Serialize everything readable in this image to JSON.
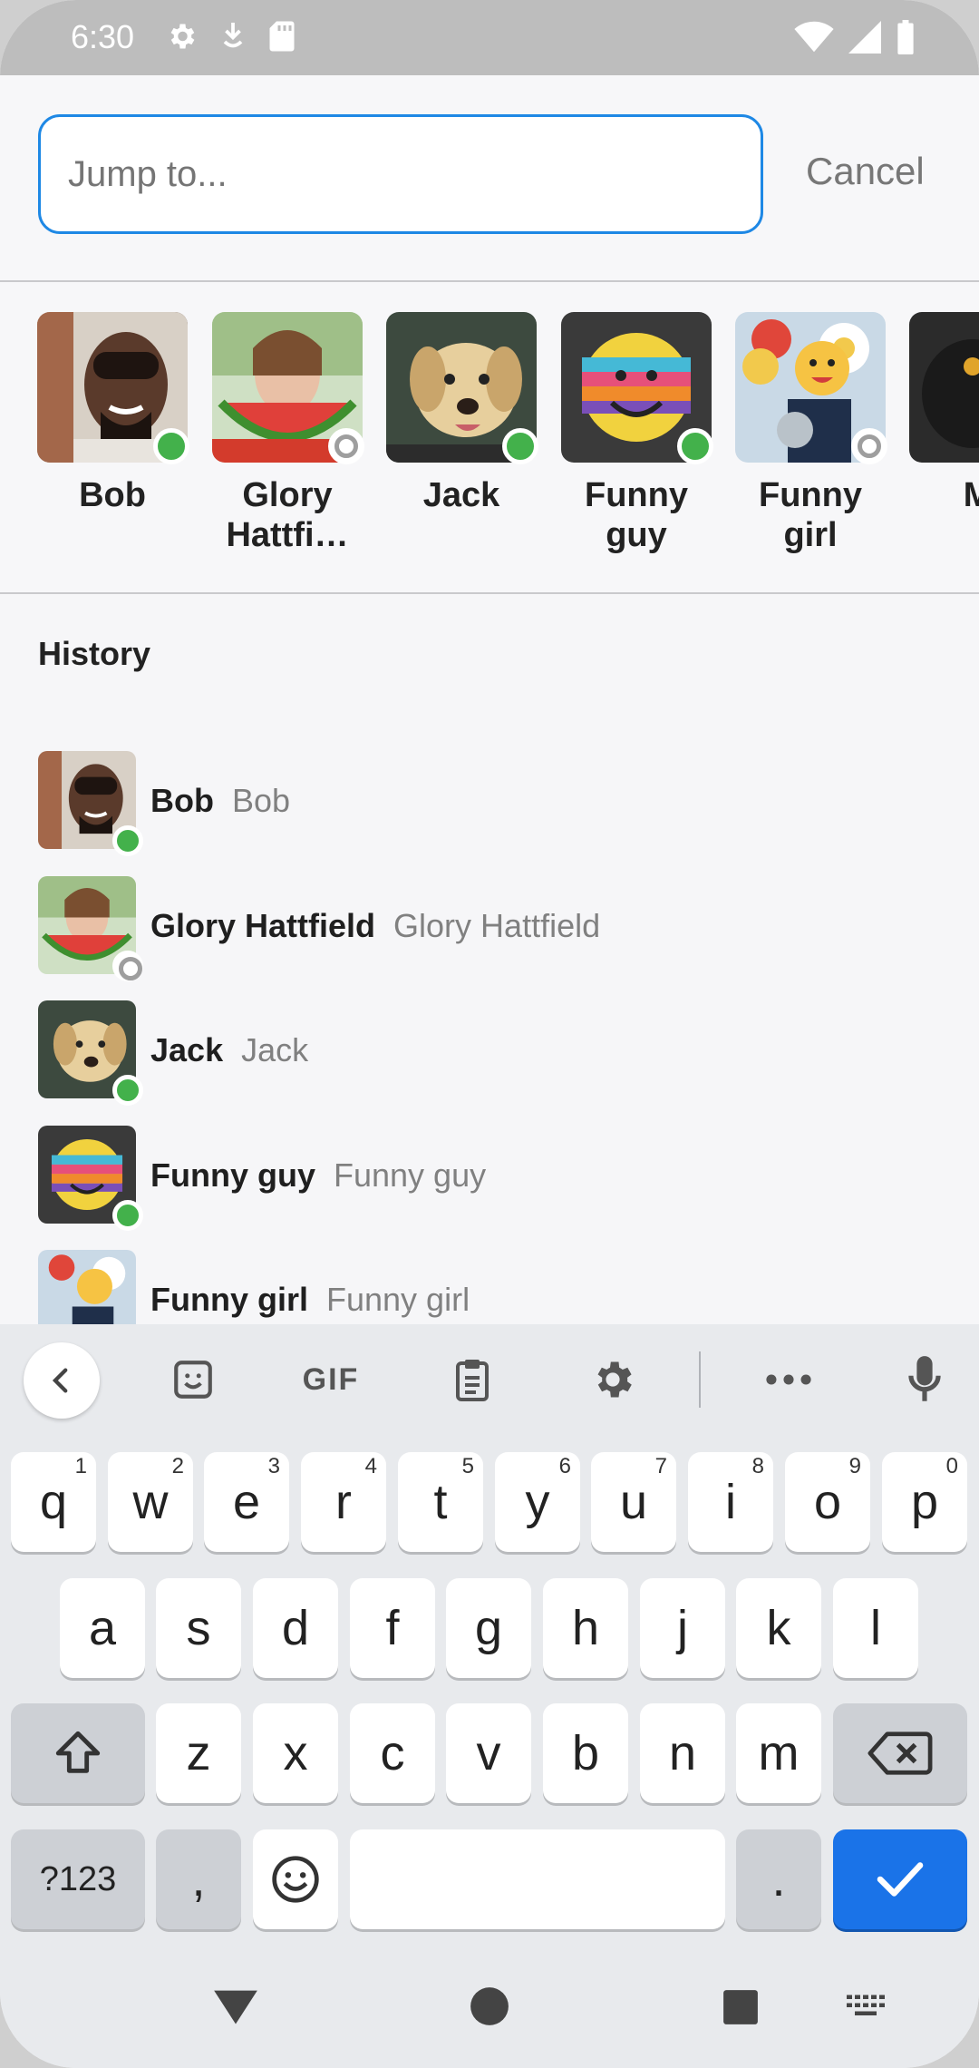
{
  "status_bar": {
    "time": "6:30"
  },
  "search": {
    "placeholder": "Jump to...",
    "cancel_label": "Cancel"
  },
  "suggested": [
    {
      "name": "Bob",
      "status": "online"
    },
    {
      "name": "Glory\nHattfi…",
      "status": "offline"
    },
    {
      "name": "Jack",
      "status": "online"
    },
    {
      "name": "Funny\nguy",
      "status": "online"
    },
    {
      "name": "Funny\ngirl",
      "status": "offline"
    },
    {
      "name": "Mr",
      "status": "online"
    }
  ],
  "history": {
    "title": "History",
    "items": [
      {
        "name": "Bob",
        "sub": "Bob",
        "status": "online"
      },
      {
        "name": "Glory Hattfield",
        "sub": "Glory Hattfield",
        "status": "offline"
      },
      {
        "name": "Jack",
        "sub": "Jack",
        "status": "online"
      },
      {
        "name": "Funny guy",
        "sub": "Funny guy",
        "status": "online"
      },
      {
        "name": "Funny girl",
        "sub": "Funny girl",
        "status": "offline"
      }
    ]
  },
  "keyboard": {
    "toolbar": {
      "gif_label": "GIF"
    },
    "row1": [
      {
        "key": "q",
        "hint": "1"
      },
      {
        "key": "w",
        "hint": "2"
      },
      {
        "key": "e",
        "hint": "3"
      },
      {
        "key": "r",
        "hint": "4"
      },
      {
        "key": "t",
        "hint": "5"
      },
      {
        "key": "y",
        "hint": "6"
      },
      {
        "key": "u",
        "hint": "7"
      },
      {
        "key": "i",
        "hint": "8"
      },
      {
        "key": "o",
        "hint": "9"
      },
      {
        "key": "p",
        "hint": "0"
      }
    ],
    "row2": [
      "a",
      "s",
      "d",
      "f",
      "g",
      "h",
      "j",
      "k",
      "l"
    ],
    "row3": [
      "z",
      "x",
      "c",
      "v",
      "b",
      "n",
      "m"
    ],
    "symbols_label": "?123",
    "comma_label": ",",
    "period_label": "."
  },
  "colors": {
    "accent": "#1e88e5",
    "online": "#43b14b",
    "offline": "#9e9e9e",
    "enter_key": "#1a73e8"
  }
}
